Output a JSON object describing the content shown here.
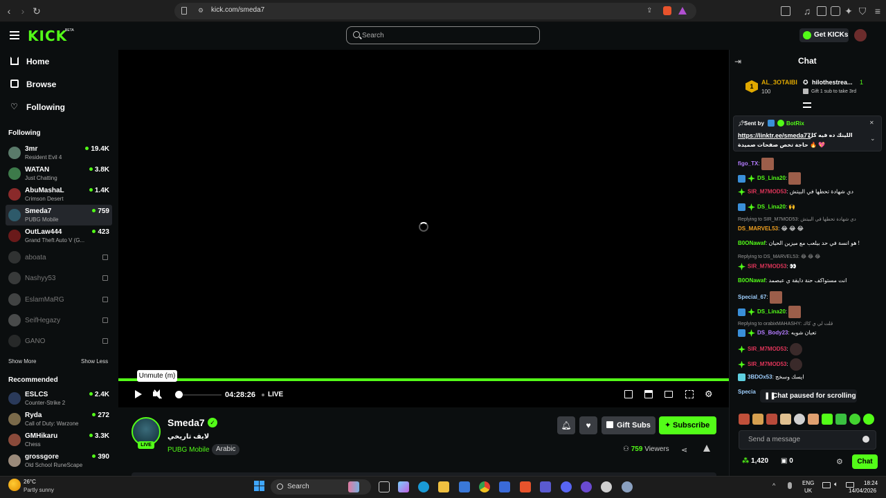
{
  "browser": {
    "url": "kick.com/smeda7"
  },
  "header": {
    "logo": "KICK",
    "beta": "BETA",
    "search_placeholder": "Search",
    "get_kicks": "Get KICKs"
  },
  "sidebar": {
    "nav": [
      {
        "label": "Home"
      },
      {
        "label": "Browse"
      },
      {
        "label": "Following"
      }
    ],
    "following_title": "Following",
    "following": [
      {
        "name": "3mr",
        "game": "Resident Evil 4",
        "viewers": "19.4K"
      },
      {
        "name": "WATAN",
        "game": "Just Chatting",
        "viewers": "3.8K"
      },
      {
        "name": "AbuMashaL",
        "game": "Crimson Desert",
        "viewers": "1.4K"
      },
      {
        "name": "Smeda7",
        "game": "PUBG Mobile",
        "viewers": "759"
      },
      {
        "name": "OutLaw444",
        "game": "Grand Theft Auto V (G...",
        "viewers": "423"
      }
    ],
    "offline": [
      {
        "name": "aboata"
      },
      {
        "name": "Nashyy53"
      },
      {
        "name": "EslamMaRG"
      },
      {
        "name": "SeifHegazy"
      },
      {
        "name": "GANO"
      }
    ],
    "show_more": "Show More",
    "show_less": "Show Less",
    "recommended_title": "Recommended",
    "recommended": [
      {
        "name": "ESLCS",
        "game": "Counter-Strike 2",
        "viewers": "2.4K"
      },
      {
        "name": "Ryda",
        "game": "Call of Duty: Warzone",
        "viewers": "272"
      },
      {
        "name": "GMHikaru",
        "game": "Chess",
        "viewers": "3.3K"
      },
      {
        "name": "grossgore",
        "game": "Old School RuneScape",
        "viewers": "390"
      }
    ]
  },
  "player": {
    "tooltip": "Unmute (m)",
    "time": "04:28:26",
    "live": "LIVE"
  },
  "stream": {
    "channel": "Smeda7",
    "live_badge": "LIVE",
    "title": "لايف تاريخي",
    "category": "PUBG Mobile",
    "tag": "Arabic",
    "gift_subs": "Gift Subs",
    "subscribe": "Subscribe",
    "viewers_count": "759",
    "viewers_label": "Viewers"
  },
  "chat": {
    "title": "Chat",
    "leader1": {
      "name": "AL_3OTAIBI",
      "value": "100",
      "rank": "1"
    },
    "leader2": {
      "name": "hilothestrea...",
      "value": "1",
      "sub": "Gift 1 sub to take 3rd"
    },
    "pinned": {
      "sent_by": "Sent by",
      "bot": "BotRix",
      "link": "https://linktr.ee/smeda77",
      "msg1": "اللينك ده فيه كل",
      "msg2": "حاجة تخص صفحات صميدة 🔥 💖"
    },
    "messages": [
      {
        "user": "figo_TX",
        "color": "#b47cff",
        "text": ":"
      },
      {
        "user": "DS_Lina20",
        "color": "#53fc18",
        "text": ":"
      },
      {
        "user": "SIR_M7MOD53",
        "color": "#e0355a",
        "text": ": دي شهادة تحطها في البيتش"
      },
      {
        "user": "DS_Lina20",
        "color": "#53fc18",
        "text": ": 🙌"
      },
      {
        "user": "DS_MARVEL53",
        "color": "#f0a020",
        "text": ": 😂 😂 😂"
      },
      {
        "user": "B0ONawaf",
        "color": "#53fc18",
        "text": ": هو انسة في حد بيلعب مع ميزين الحيان !"
      },
      {
        "user": "SIR_M7MOD53",
        "color": "#e0355a",
        "text": ": 👀"
      },
      {
        "user": "B0ONawaf",
        "color": "#53fc18",
        "text": ": انت مستواكف حنة دايقة ي عبصمد"
      },
      {
        "user": "Special_67",
        "color": "#9fd0ff",
        "text": ":"
      },
      {
        "user": "DS_Lina20",
        "color": "#53fc18",
        "text": ":"
      },
      {
        "user": "DS_Body23",
        "color": "#b47cff",
        "text": ": تعبان شويه"
      },
      {
        "user": "SIR_M7MOD53",
        "color": "#e0355a",
        "text": ":"
      },
      {
        "user": "SIR_M7MOD53",
        "color": "#e0355a",
        "text": ":"
      },
      {
        "user": "3BDOx53",
        "color": "#9fd0ff",
        "text": ": ايسك وسخج"
      }
    ],
    "replies": [
      {
        "text": "Replying to SIR_M7MOD53: دي شهادة تحطها في البيتش"
      },
      {
        "text": "Replying to DS_MARVEL53: 😂 😂 😂"
      },
      {
        "text": "Replying to orabixMAHASHY: قلت لي ي كاك"
      }
    ],
    "paused": "Chat paused for scrolling",
    "partial_user": "Specia",
    "placeholder": "Send a message",
    "points": "1,420",
    "gifts": "0",
    "chat_button": "Chat"
  },
  "taskbar": {
    "temp": "26°C",
    "condition": "Partly sunny",
    "search": "Search",
    "lang1": "ENG",
    "lang2": "UK",
    "time": "18:24",
    "date": "14/04/2026"
  },
  "colors": {
    "accent": "#53fc18",
    "bg": "#0b0e0f",
    "panel": "#1a1d21"
  }
}
